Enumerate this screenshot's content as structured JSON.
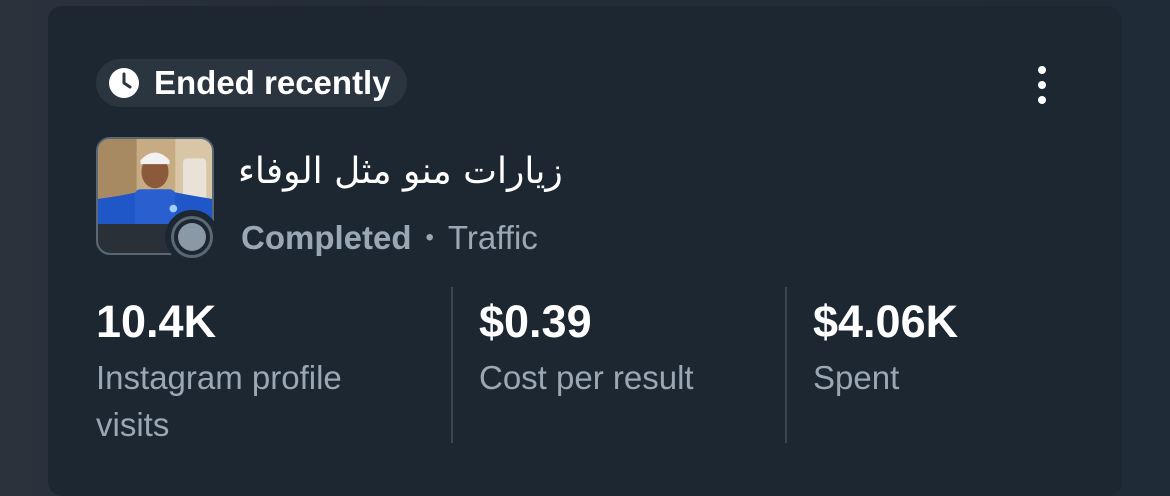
{
  "campaign": {
    "status_badge": "Ended recently",
    "name": "زيارات منو مثل الوفاء",
    "delivery_status": "Completed",
    "separator": "•",
    "objective": "Traffic"
  },
  "metrics": [
    {
      "value": "10.4K",
      "label": "Instagram profile visits"
    },
    {
      "value": "$0.39",
      "label": "Cost per result"
    },
    {
      "value": "$4.06K",
      "label": "Spent"
    }
  ],
  "icons": {
    "status": "clock-icon",
    "menu": "more-vertical-icon"
  },
  "colors": {
    "card": "#1d2731",
    "text_primary": "#ffffff",
    "text_secondary": "#9aa7b4"
  }
}
